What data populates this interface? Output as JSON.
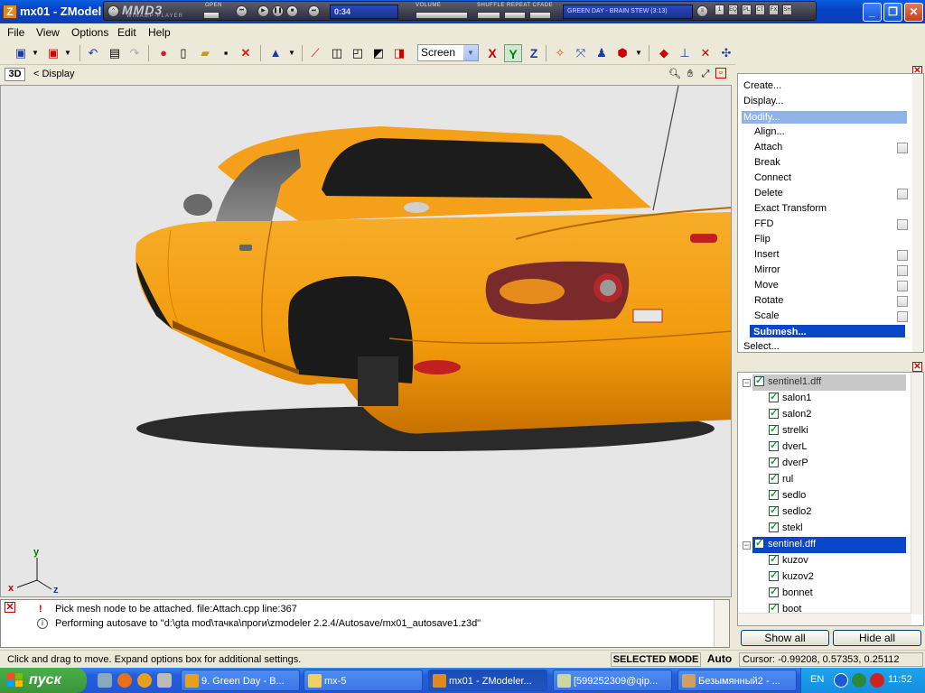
{
  "window": {
    "title": "mx01 - ZModel",
    "icon": "Z"
  },
  "winamp": {
    "logo": "MMD3",
    "subtitle": "WINAMP-PLAYER",
    "time": "0:34",
    "labels": {
      "open": "OPEN",
      "volume": "VOLUME",
      "shuffle": "SHUFFLE REPEAT CFADE"
    },
    "track": "GREEN DAY - BRAIN STEW (3:13)",
    "toggles": [
      "1",
      "EQ",
      "PL",
      "CT",
      "FX",
      "SH"
    ]
  },
  "menu": [
    "File",
    "View",
    "Options",
    "Edit",
    "Help"
  ],
  "toolbar": {
    "coord_system": "Screen",
    "axes": [
      "X",
      "Y",
      "Z"
    ],
    "colors": {
      "x": "#c00000",
      "y": "#008000",
      "z": "#1a3aa8"
    }
  },
  "viewport": {
    "mode_badge": "3D",
    "menu_label": "< Display",
    "axis_labels": {
      "x": "x",
      "y": "y",
      "z": "z"
    },
    "model_colors": {
      "body": "#f29a0c",
      "shadow": "#a95e00",
      "tail_light": "#8a2626",
      "ground": "#e6e6e6"
    }
  },
  "commands": {
    "top": [
      "Create...",
      "Display...",
      "Modify..."
    ],
    "sub": [
      {
        "label": "Align...",
        "check": false
      },
      {
        "label": "Attach",
        "check": true
      },
      {
        "label": "Break",
        "check": false
      },
      {
        "label": "Connect",
        "check": false
      },
      {
        "label": "Delete",
        "check": true
      },
      {
        "label": "Exact Transform",
        "check": false
      },
      {
        "label": "FFD",
        "check": true
      },
      {
        "label": "Flip",
        "check": false
      },
      {
        "label": "Insert",
        "check": true
      },
      {
        "label": "Mirror",
        "check": true
      },
      {
        "label": "Move",
        "check": true
      },
      {
        "label": "Rotate",
        "check": true
      },
      {
        "label": "Scale",
        "check": true
      }
    ],
    "selected": "Submesh...",
    "bottom": "Select..."
  },
  "tree": {
    "groups": [
      {
        "name": "sentinel1.dff",
        "children": [
          "salon1",
          "salon2",
          "strelki",
          "dverL",
          "dverP",
          "rul",
          "sedlo",
          "sedlo2",
          "stekl"
        ]
      },
      {
        "name": "sentinel.dff",
        "children": [
          "kuzov",
          "kuzov2",
          "bonnet",
          "boot"
        ]
      }
    ],
    "show_all": "Show all",
    "hide_all": "Hide all"
  },
  "log": [
    {
      "icon": "warning",
      "text": "Pick mesh node to be attached. file:Attach.cpp line:367"
    },
    {
      "icon": "info",
      "text": "Performing autosave to \"d:\\gta mod\\тачка\\проги\\zmodeler 2.2.4/Autosave/mx01_autosave1.z3d\""
    }
  ],
  "status": {
    "hint": "Click and drag to move. Expand options box for additional settings.",
    "mode": "SELECTED MODE",
    "auto": "Auto",
    "cursor": "Cursor: -0.99208, 0.57353, 0.25112"
  },
  "taskbar": {
    "start": "пуск",
    "tasks": [
      {
        "label": "9. Green Day - B...",
        "active": false
      },
      {
        "label": "mx-5",
        "active": false
      },
      {
        "label": "mx01 - ZModeler...",
        "active": true
      },
      {
        "label": "[599252309@qip...",
        "active": false
      },
      {
        "label": "Безымянный2 - ...",
        "active": false
      }
    ],
    "lang": "EN",
    "clock": "11:52"
  }
}
